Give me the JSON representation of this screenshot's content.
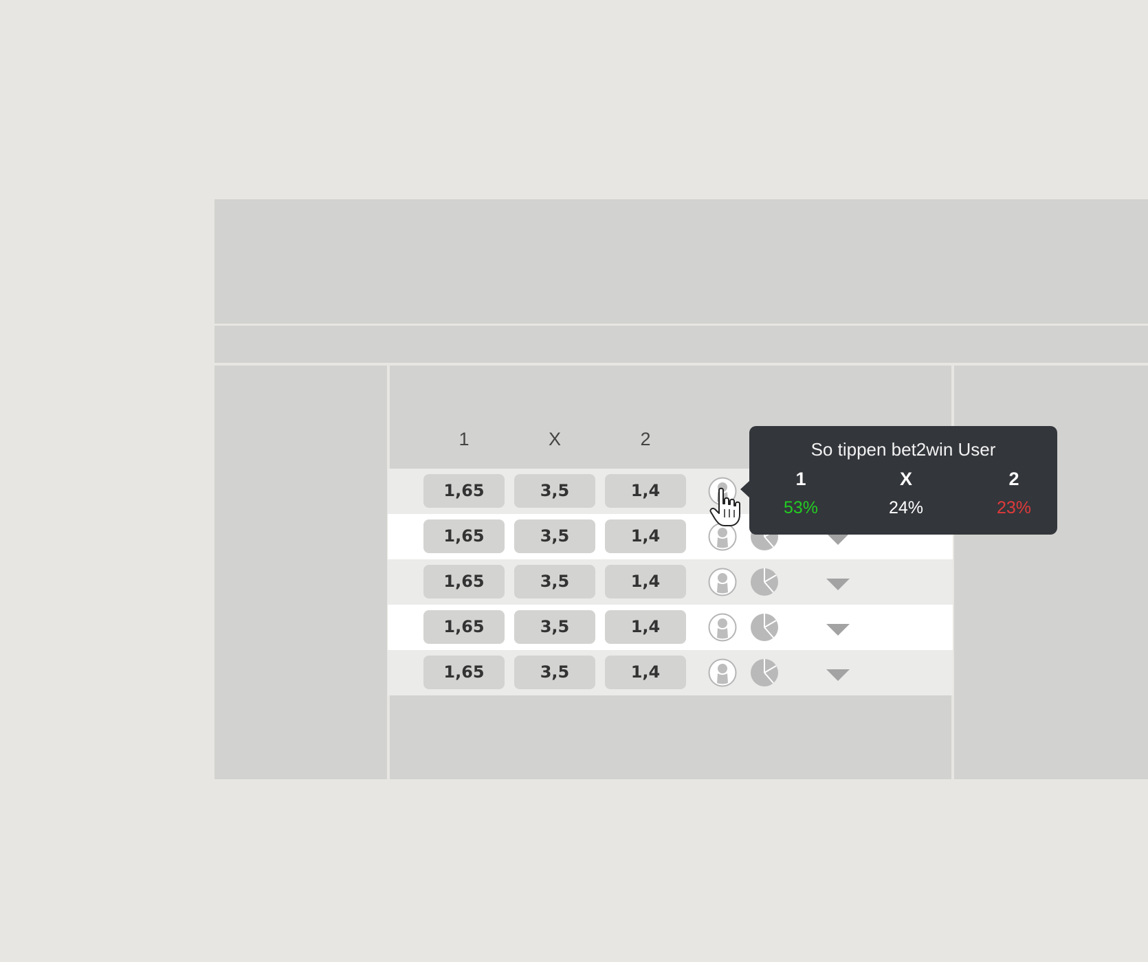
{
  "table": {
    "headers": [
      "1",
      "X",
      "2"
    ],
    "rows": [
      {
        "odd1": "1,65",
        "oddx": "3,5",
        "odd2": "1,4"
      },
      {
        "odd1": "1,65",
        "oddx": "3,5",
        "odd2": "1,4"
      },
      {
        "odd1": "1,65",
        "oddx": "3,5",
        "odd2": "1,4"
      },
      {
        "odd1": "1,65",
        "oddx": "3,5",
        "odd2": "1,4"
      },
      {
        "odd1": "1,65",
        "oddx": "3,5",
        "odd2": "1,4"
      }
    ],
    "row_icons": [
      "user-icon",
      "pie-chart-icon",
      "chevron-down-icon"
    ]
  },
  "tooltip": {
    "title": "So tippen bet2win User",
    "columns": [
      {
        "label": "1",
        "value": "53%",
        "color": "#22cc22"
      },
      {
        "label": "X",
        "value": "24%",
        "color": "#ffffff"
      },
      {
        "label": "2",
        "value": "23%",
        "color": "#e03a3a"
      }
    ]
  },
  "colors": {
    "background": "#e7e6e2",
    "panel": "#d2d2d0",
    "row_alt": "#ebebea",
    "tooltip_bg": "#33363b"
  }
}
